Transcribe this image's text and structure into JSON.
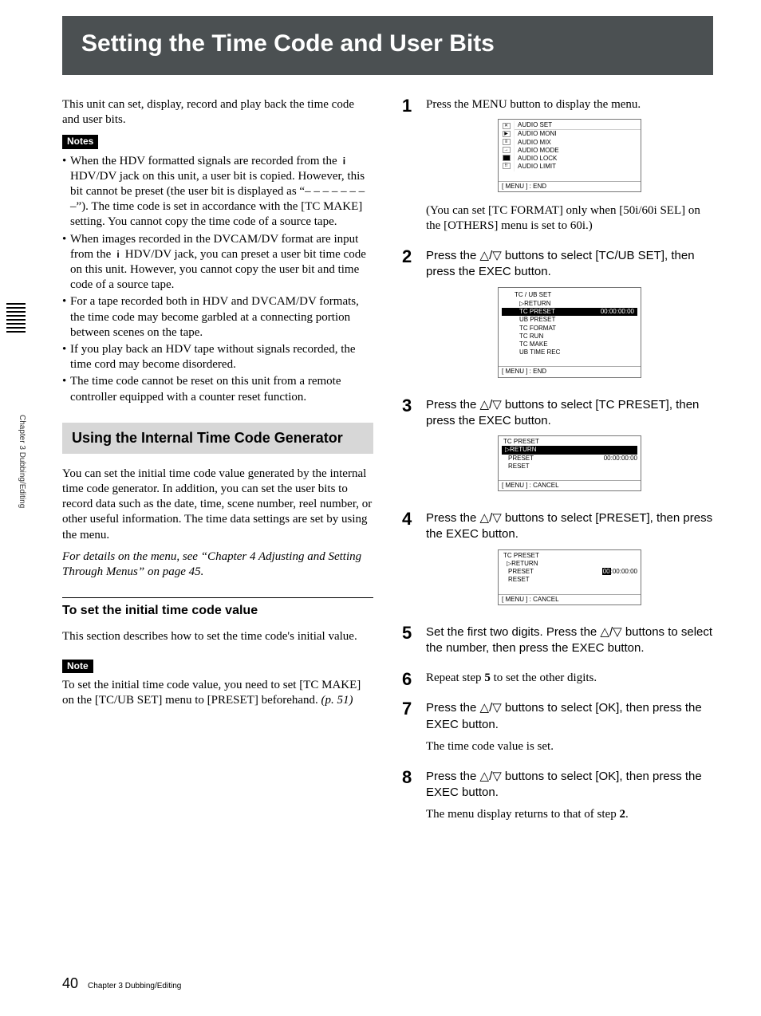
{
  "title": "Setting the Time Code and User Bits",
  "side_tab": "Chapter 3   Dubbing/Editing",
  "intro": "This unit can set, display, record and play back the time code and user bits.",
  "notes_label": "Notes",
  "notes": [
    "When the HDV formatted signals are recorded from the  HDV/DV jack on this unit, a user bit is copied. However, this bit cannot be preset (the user bit is displayed as “– –  – –  – –  – –”).  The time code is set in accordance with the [TC MAKE] setting.  You cannot copy the time code of a source tape.",
    "When images recorded in the DVCAM/DV format are input from the  HDV/DV jack, you can preset a user bit time code on this unit.  However, you cannot copy the user bit and time code of a source tape.",
    "For a tape recorded both in HDV and DVCAM/DV formats, the time code may become garbled at a connecting portion between scenes on the tape.",
    "If you play back an HDV tape without signals recorded, the time cord may become disordered.",
    "The time code cannot be reset on this unit from a remote controller equipped with a counter reset function."
  ],
  "section_head": "Using the Internal Time Code Generator",
  "section_body": "You can set the initial time code value generated by the internal time code generator. In addition, you can set the user bits to record data such as the date, time, scene number, reel number, or other useful information. The time data settings are set by using the menu.",
  "section_ref": "For details on the menu, see “Chapter 4 Adjusting and Setting Through Menus” on page 45.",
  "sub_head": "To set the initial time code value",
  "sub_body": "This section describes how to set the time code's initial value.",
  "note_label": "Note",
  "note_body_a": "To set the initial time code value, you need to set [TC MAKE] on the [TC/UB SET] menu to [PRESET] beforehand. ",
  "note_body_b": "(p. 51)",
  "steps": [
    {
      "n": "1",
      "text": "Press the MENU button to display the menu.",
      "after": "(You can set [TC FORMAT] only when [50i/60i SEL] on the [OTHERS] menu is set to 60i.)"
    },
    {
      "n": "2",
      "text": "Press the △/▽ buttons to select [TC/UB SET], then press the EXEC button."
    },
    {
      "n": "3",
      "text": "Press the △/▽ buttons to select [TC PRESET], then press the EXEC button."
    },
    {
      "n": "4",
      "text": "Press the △/▽ buttons to select [PRESET], then press the EXEC button."
    },
    {
      "n": "5",
      "text": "Set the first two digits. Press the △/▽ buttons to select the number, then press the EXEC button."
    },
    {
      "n": "6",
      "text_a": "Repeat step ",
      "text_bold": "5",
      "text_b": " to set the other digits."
    },
    {
      "n": "7",
      "text": "Press the △/▽ buttons to select [OK], then press the EXEC button.",
      "after": "The time code value is set."
    },
    {
      "n": "8",
      "text": "Press the △/▽ buttons to select [OK], then press the EXEC button.",
      "after_a": "The menu display returns to that of step ",
      "after_bold": "2",
      "after_b": "."
    }
  ],
  "menus": {
    "audio": {
      "head": "AUDIO SET",
      "items": [
        "AUDIO MONI",
        "AUDIO MIX",
        "AUDIO MODE",
        "AUDIO LOCK",
        "AUDIO LIMIT"
      ],
      "footer": "[ MENU ] : END"
    },
    "tcub": {
      "head": "TC / UB SET",
      "return": "▷RETURN",
      "sel": "TC PRESET",
      "sel_val": "00:00:00:00",
      "items": [
        "UB PRESET",
        "TC FORMAT",
        "TC RUN",
        "TC MAKE",
        "UB TIME REC"
      ],
      "footer": "[ MENU ] : END"
    },
    "tcpreset1": {
      "head": "TC PRESET",
      "sel": "▷RETURN",
      "row1_l": "PRESET",
      "row1_r": "00:00:00:00",
      "row2": "RESET",
      "footer": "[ MENU ] : CANCEL"
    },
    "tcpreset2": {
      "head": "TC PRESET",
      "row0": "▷RETURN",
      "row1_l": "PRESET",
      "row1_r_pre": "00",
      "row1_r_post": ":00:00:00",
      "row2": "RESET",
      "footer": "[ MENU ] : CANCEL"
    }
  },
  "footer": {
    "num": "40",
    "text": "Chapter 3    Dubbing/Editing"
  }
}
